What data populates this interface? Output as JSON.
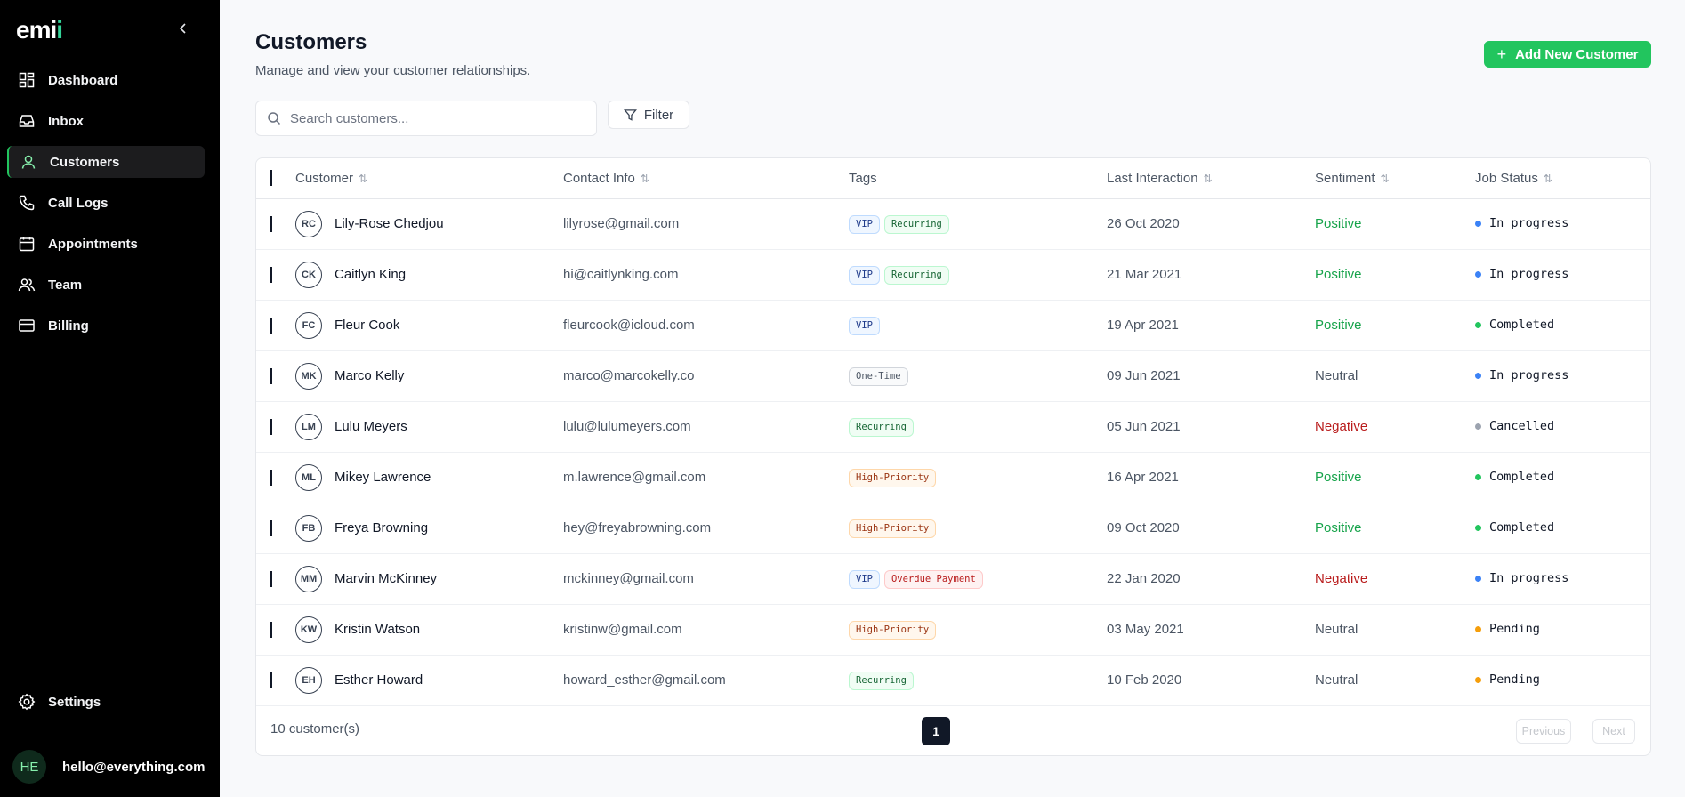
{
  "app": {
    "logo_main": "emi",
    "logo_accent": "i"
  },
  "sidebar": {
    "collapse_icon": "chevron-left-icon",
    "items": [
      {
        "label": "Dashboard",
        "icon": "grid-icon"
      },
      {
        "label": "Inbox",
        "icon": "inbox-icon"
      },
      {
        "label": "Customers",
        "icon": "user-icon",
        "active": true
      },
      {
        "label": "Call Logs",
        "icon": "phone-icon"
      },
      {
        "label": "Appointments",
        "icon": "calendar-icon"
      },
      {
        "label": "Team",
        "icon": "users-icon"
      },
      {
        "label": "Billing",
        "icon": "credit-card-icon"
      }
    ],
    "settings_label": "Settings",
    "user": {
      "initials": "HE",
      "email": "hello@everything.com"
    }
  },
  "header": {
    "title": "Customers",
    "subtitle": "Manage and view your customer relationships.",
    "add_button": "Add New Customer"
  },
  "toolbar": {
    "search_placeholder": "Search customers...",
    "search_value": "",
    "filter_label": "Filter"
  },
  "table": {
    "columns": [
      "Customer",
      "Contact Info",
      "Tags",
      "Last Interaction",
      "Sentiment",
      "Job Status"
    ],
    "rows": [
      {
        "initials": "RC",
        "name": "Lily-Rose Chedjou",
        "email": "lilyrose@gmail.com",
        "tags": [
          "VIP",
          "Recurring"
        ],
        "date": "26 Oct 2020",
        "sentiment": "Positive",
        "status": "In progress"
      },
      {
        "initials": "CK",
        "name": "Caitlyn King",
        "email": "hi@caitlynking.com",
        "tags": [
          "VIP",
          "Recurring"
        ],
        "date": "21 Mar 2021",
        "sentiment": "Positive",
        "status": "In progress"
      },
      {
        "initials": "FC",
        "name": "Fleur Cook",
        "email": "fleurcook@icloud.com",
        "tags": [
          "VIP"
        ],
        "date": "19 Apr 2021",
        "sentiment": "Positive",
        "status": "Completed"
      },
      {
        "initials": "MK",
        "name": "Marco Kelly",
        "email": "marco@marcokelly.co",
        "tags": [
          "One-Time"
        ],
        "date": "09 Jun 2021",
        "sentiment": "Neutral",
        "status": "In progress"
      },
      {
        "initials": "LM",
        "name": "Lulu Meyers",
        "email": "lulu@lulumeyers.com",
        "tags": [
          "Recurring"
        ],
        "date": "05 Jun 2021",
        "sentiment": "Negative",
        "status": "Cancelled"
      },
      {
        "initials": "ML",
        "name": "Mikey Lawrence",
        "email": "m.lawrence@gmail.com",
        "tags": [
          "High-Priority"
        ],
        "date": "16 Apr 2021",
        "sentiment": "Positive",
        "status": "Completed"
      },
      {
        "initials": "FB",
        "name": "Freya Browning",
        "email": "hey@freyabrowning.com",
        "tags": [
          "High-Priority"
        ],
        "date": "09 Oct 2020",
        "sentiment": "Positive",
        "status": "Completed"
      },
      {
        "initials": "MM",
        "name": "Marvin McKinney",
        "email": "mckinney@gmail.com",
        "tags": [
          "VIP",
          "Overdue Payment"
        ],
        "date": "22 Jan 2020",
        "sentiment": "Negative",
        "status": "In progress"
      },
      {
        "initials": "KW",
        "name": "Kristin Watson",
        "email": "kristinw@gmail.com",
        "tags": [
          "High-Priority"
        ],
        "date": "03 May 2021",
        "sentiment": "Neutral",
        "status": "Pending"
      },
      {
        "initials": "EH",
        "name": "Esther Howard",
        "email": "howard_esther@gmail.com",
        "tags": [
          "Recurring"
        ],
        "date": "10 Feb 2020",
        "sentiment": "Neutral",
        "status": "Pending"
      }
    ]
  },
  "footer": {
    "count": "10 customer(s)",
    "page": "1",
    "previous": "Previous",
    "next": "Next"
  },
  "colors": {
    "accent": "#22c55e",
    "status_in_progress": "#3b82f6",
    "status_completed": "#22c55e",
    "status_cancelled": "#9ca3af",
    "status_pending": "#f59e0b"
  }
}
